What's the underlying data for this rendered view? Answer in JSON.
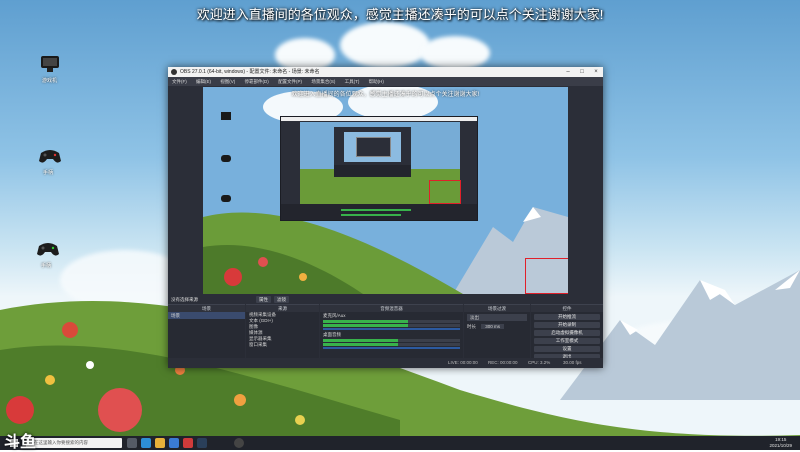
{
  "desktop": {
    "banner": "欢迎进入直播间的各位观众，感觉主播还凑乎的可以点个关注谢谢大家!",
    "icons": [
      {
        "name": "game-controller-icon",
        "label": "游戏机"
      },
      {
        "name": "gamepad-icon",
        "label": "手柄"
      },
      {
        "name": "gamepad-icon",
        "label": "手柄"
      }
    ]
  },
  "obs": {
    "title": "OBS 27.0.1 (64-bit, windows) - 配置文件: 未命名 - 场景: 未命名",
    "menu": [
      "文件(F)",
      "编辑(E)",
      "视图(V)",
      "停靠部件(D)",
      "配置文件(P)",
      "场景集合(S)",
      "工具(T)",
      "帮助(H)"
    ],
    "preview_banner": "欢迎进入直播间的各位观众，感觉主播还凑乎的可以点个关注谢谢大家!",
    "toolbar": {
      "no_source": "没有选择来源",
      "properties": "属性",
      "filters": "滤镜"
    },
    "scenes": {
      "title": "场景",
      "items": [
        "场景"
      ]
    },
    "sources": {
      "title": "来源",
      "items": [
        "视频采集设备",
        "文本 (GDI+)",
        "图像",
        "媒体源",
        "显示器采集",
        "窗口采集"
      ]
    },
    "mixer": {
      "title": "音频混音器",
      "channels": [
        {
          "name": "麦克风/Aux",
          "level": 0.62
        },
        {
          "name": "桌面音频",
          "level": 0.55
        }
      ]
    },
    "transitions": {
      "title": "场景过渡",
      "type": "淡出",
      "duration_label": "时长",
      "duration": "300 ms"
    },
    "controls": {
      "title": "控件",
      "buttons": [
        "开始推流",
        "开始录制",
        "启动虚拟摄像机",
        "工作室模式",
        "设置",
        "退出"
      ]
    },
    "status": {
      "live": "LIVE: 00:00:00",
      "rec": "REC: 00:00:00",
      "cpu": "CPU: 3.2%",
      "fps": "30.00 fps"
    }
  },
  "taskbar": {
    "search_placeholder": "在这里输入你要搜索的内容",
    "time": "19:15",
    "date": "2021/10/29"
  },
  "corner_logo": "斗鱼"
}
